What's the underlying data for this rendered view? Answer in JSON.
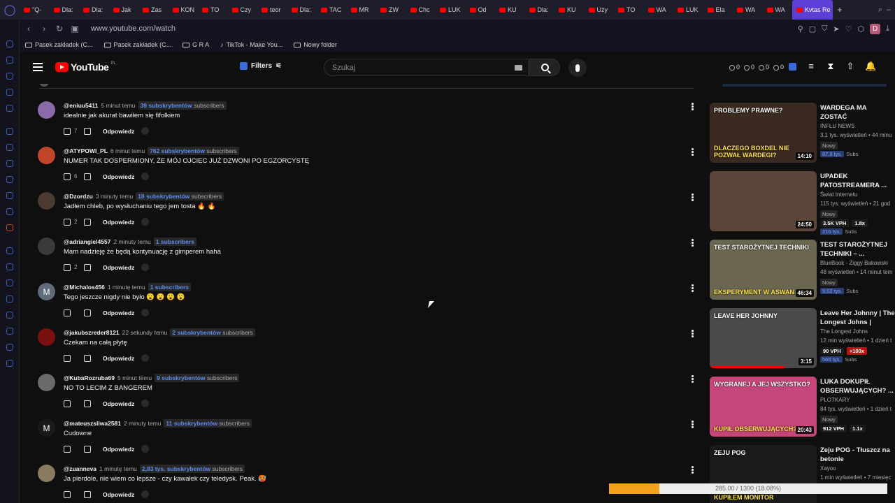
{
  "browser": {
    "tabs": [
      "\"Q-",
      "Dla:",
      "Dla:",
      "Jak",
      "Zas",
      "KON",
      "TO",
      "Czy",
      "teor",
      "Dla:",
      "TAC",
      "MR",
      "ZW",
      "Chc",
      "LUK",
      "Od",
      "KU",
      "Dla:",
      "KU",
      "Uży",
      "TO",
      "WA",
      "LUK",
      "Ela",
      "WA",
      "WA"
    ],
    "active_tab": "Kvtas Re",
    "url": "www.youtube.com/watch",
    "bookmarks": [
      "Pasek zakładek (C...",
      "Pasek zakładek (C...",
      "G R A",
      "TikTok - Make You...",
      "Nowy folder"
    ],
    "avatar_letter": "D",
    "accent": "#5b3fd6"
  },
  "header": {
    "logo_text": "YouTube",
    "logo_region": "PL",
    "filters_label": "Filters",
    "search_placeholder": "Szukaj",
    "stats": [
      "0",
      "0",
      "0",
      "0"
    ]
  },
  "comments": [
    {
      "user": "@eniuu5411",
      "time": "5 minut temu",
      "subs_count": "39 subskrybentów",
      "subs_suffix": "subscribers",
      "text": "idealnie jak akurat bawiłem się fifolkiem",
      "likes": "7",
      "reply": "Odpowiedz",
      "avatar_color": "#8a6aa8"
    },
    {
      "user": "@ATYPOWI_PL",
      "time": "6 minut temu",
      "subs_count": "762 subskrybentów",
      "subs_suffix": "subscribers",
      "text": "NUMER TAK DOSPERMIONY, ŻE MÓJ OJCIEC JUŻ DZWONI PO EGZORCYSTĘ",
      "likes": "6",
      "reply": "Odpowiedz",
      "avatar_color": "#c0452a"
    },
    {
      "user": "@Dzordzu",
      "time": "3 minuty temu",
      "subs_count": "18 subskrybentów",
      "subs_suffix": "subscribers",
      "text": "Jadłem chleb, po wysłuchaniu tego jem tosta 🔥 🔥",
      "likes": "2",
      "reply": "Odpowiedz",
      "avatar_color": "#4a3a30"
    },
    {
      "user": "@adriangiel4557",
      "time": "2 minuty temu",
      "subs_count": "1 subscribers",
      "subs_suffix": "",
      "text": "Mam nadzieję że będą kontynuację z gimperem haha",
      "likes": "2",
      "reply": "Odpowiedz",
      "avatar_color": "#3a3a3a"
    },
    {
      "user": "@Michalos456",
      "time": "1 minutę temu",
      "subs_count": "1 subscribers",
      "subs_suffix": "",
      "text": "Tego jeszcze nigdy nie było 😮 😮 😮 😮",
      "likes": "",
      "reply": "Odpowiedz",
      "avatar_color": "#5f6b7a",
      "avatar_letter": "M"
    },
    {
      "user": "@jakubszreder8121",
      "time": "22 sekundy temu",
      "subs_count": "2 subskrybentów",
      "subs_suffix": "subscribers",
      "text": "Czekam na całą płytę",
      "likes": "",
      "reply": "Odpowiedz",
      "avatar_color": "#7a1010"
    },
    {
      "user": "@KubaRozruba69",
      "time": "5 minut temu",
      "subs_count": "9 subskrybentów",
      "subs_suffix": "subscribers",
      "text": "NO TO LECIM Z BANGEREM",
      "likes": "",
      "reply": "Odpowiedz",
      "avatar_color": "#6a6a6a"
    },
    {
      "user": "@mateuszsliwa2581",
      "time": "2 minuty temu",
      "subs_count": "11 subskrybentów",
      "subs_suffix": "subscribers",
      "text": "Cudowne",
      "likes": "",
      "reply": "Odpowiedz",
      "avatar_color": "#1a1a1a",
      "avatar_letter": "M"
    },
    {
      "user": "@zuanneva",
      "time": "1 minutę temu",
      "subs_count": "2,83 tys. subskrybentów",
      "subs_suffix": "subscribers",
      "text": "Ja pierdole, nie wiem co lepsze - czy kawałek czy teledysk. Peak. 🥵",
      "likes": "",
      "reply": "Odpowiedz",
      "avatar_color": "#8a7a60"
    }
  ],
  "related": [
    {
      "title": "WARDEGA MA ZOSTAĆ ZLIKWIDOWANY? ...",
      "channel": "INFLU NEWS",
      "meta": "3,1 tys. wyświetleń • 44 minu",
      "badge": "Nowy",
      "subs_count": "87,9 tys.",
      "subs_label": "Subs",
      "duration": "14:10",
      "vph": "",
      "ratio": "",
      "thumb_color": "#3b2a22",
      "overlay_top": "PROBLEMY PRAWNE?",
      "overlay_bottom": "DLACZEGO BOXDEL NIE POZWAŁ WARDEGI?"
    },
    {
      "title": "UPADEK PATOSTREAMERA ...",
      "channel": "Świat Internetu",
      "meta": "115 tys. wyświetleń • 21 god",
      "badge": "Nowy",
      "subs_count": "216 tys.",
      "subs_label": "Subs",
      "duration": "24:50",
      "vph": "3.5K VPH",
      "ratio": "1.8x",
      "thumb_color": "#5b4538"
    },
    {
      "title": "TEST STAROŻYTNEJ TECHNIKI – ...",
      "channel": "BlueBook - Ziggy Bakowski",
      "meta": "48 wyświetleń • 14 minut tem",
      "badge": "Nowy",
      "subs_count": "9,02 tys.",
      "subs_label": "Subs",
      "duration": "46:34",
      "vph": "",
      "ratio": "",
      "thumb_color": "#6a6650",
      "overlay_top": "TEST STAROŻYTNEJ TECHNIKI",
      "overlay_bottom": "EKSPERYMENT W ASWAN"
    },
    {
      "title": "Leave Her Johnny | The Longest Johns | Mass...",
      "channel": "The Longest Johns",
      "meta": "12 min wyświetleń • 1 dzień t",
      "badge": "",
      "subs_count": "566 tys.",
      "subs_label": "Subs",
      "duration": "3:15",
      "vph": "90 VPH",
      "ratio": "+100x",
      "thumb_color": "#4a4a4a",
      "overlay_top": "Leave Her Johnny"
    },
    {
      "title": "LUKA DOKUPIŁ OBSERWUJĄCYCH? ...",
      "channel": "PLOTKARY",
      "meta": "84 tys. wyświetleń • 1 dzień t",
      "badge": "Nowy",
      "subs_count": "",
      "subs_label": "",
      "duration": "20:43",
      "vph": "912 VPH",
      "ratio": "1.1x",
      "thumb_color": "#c7467a",
      "overlay_top": "WYGRANEJ A JEJ WSZYSTKO?",
      "overlay_bottom": "KUPIŁ OBSERWUJĄCYCH?"
    },
    {
      "title": "Zeju POG - Tłuszcz na betonie",
      "channel": "Xayoo",
      "meta": "1 min wyświetleń • 7 miesięc",
      "badge": "",
      "subs_count": "",
      "subs_label": "",
      "duration": "",
      "vph": "",
      "ratio": "",
      "thumb_color": "#1a1a1a",
      "overlay_top": "ZEJU POG",
      "overlay_bottom": "kupiłem monitor"
    }
  ],
  "download": {
    "label": "285.00 / 1300 (18.08%)",
    "fraction": 0.18
  },
  "colors": {
    "background": "#0f0f0f",
    "youtube_red": "#ff0000",
    "subs_blue": "#5b8df0"
  }
}
